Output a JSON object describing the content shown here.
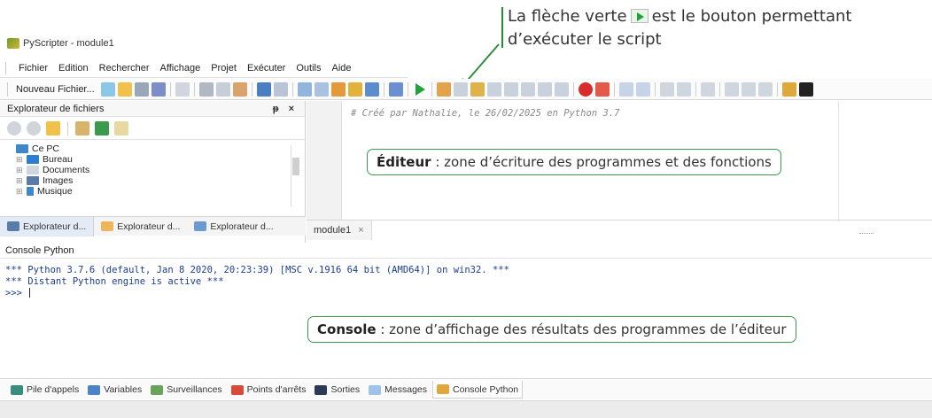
{
  "annotation_top": {
    "line1_before": "La flèche verte",
    "line1_after": "est le bouton permettant",
    "line2": "d’exécuter le script"
  },
  "window": {
    "title": "PyScripter - module1"
  },
  "menu": [
    "Fichier",
    "Edition",
    "Rechercher",
    "Affichage",
    "Projet",
    "Exécuter",
    "Outils",
    "Aide"
  ],
  "toolbar": {
    "new_file_label": "Nouveau Fichier..."
  },
  "explorer": {
    "title": "Explorateur de fichiers",
    "controls": "ᵽ ×",
    "root": "Ce PC",
    "items": [
      "Bureau",
      "Documents",
      "Images",
      "Musique"
    ],
    "tabs": [
      "Explorateur d...",
      "Explorateur d...",
      "Explorateur d..."
    ]
  },
  "editor": {
    "code_line": "# Créé par Nathalie, le 26/02/2025 en Python 3.7",
    "tab_label": "module1",
    "tab_close": "×",
    "callout_bold": "Éditeur",
    "callout_text": " : zone d’écriture des programmes et des fonctions"
  },
  "console": {
    "title": "Console Python",
    "lines": [
      "*** Python 3.7.6 (default, Jan  8 2020, 20:23:39) [MSC v.1916 64 bit (AMD64)] on win32. ***",
      "*** Distant Python engine is active ***",
      ">>> "
    ],
    "callout_bold": "Console",
    "callout_text": " : zone d’affichage des résultats des programmes de l’éditeur"
  },
  "bottom_tabs": [
    "Pile d'appels",
    "Variables",
    "Surveillances",
    "Points d'arrêts",
    "Sorties",
    "Messages",
    "Console Python"
  ],
  "colors": {
    "accent_green": "#1fa33a",
    "callout_border": "#3a9a4d",
    "console_text": "#1a3d8f"
  }
}
